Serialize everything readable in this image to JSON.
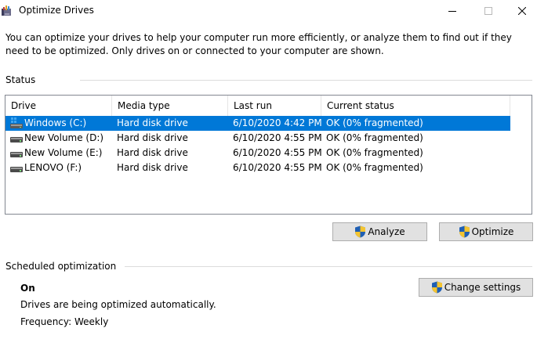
{
  "window": {
    "title": "Optimize Drives",
    "app_icon": "optimize-drives-icon",
    "controls": [
      "minimize-icon",
      "maximize-icon",
      "close-icon"
    ]
  },
  "intro_text": "You can optimize your drives to help your computer run more efficiently, or analyze them to find out if they need to be optimized. Only drives on or connected to your computer are shown.",
  "status": {
    "label": "Status",
    "columns": [
      "Drive",
      "Media type",
      "Last run",
      "Current status"
    ],
    "rows": [
      {
        "drive": "Windows (C:)",
        "icon": "system-drive-icon",
        "media": "Hard disk drive",
        "last_run": "6/10/2020 4:42 PM",
        "status": "OK (0% fragmented)",
        "selected": true
      },
      {
        "drive": "New Volume (D:)",
        "icon": "hard-drive-icon",
        "media": "Hard disk drive",
        "last_run": "6/10/2020 4:55 PM",
        "status": "OK (0% fragmented)",
        "selected": false
      },
      {
        "drive": "New Volume (E:)",
        "icon": "hard-drive-icon",
        "media": "Hard disk drive",
        "last_run": "6/10/2020 4:55 PM",
        "status": "OK (0% fragmented)",
        "selected": false
      },
      {
        "drive": "LENOVO (F:)",
        "icon": "hard-drive-icon",
        "media": "Hard disk drive",
        "last_run": "6/10/2020 4:55 PM",
        "status": "OK (0% fragmented)",
        "selected": false
      }
    ]
  },
  "actions": {
    "analyze_label": "Analyze",
    "optimize_label": "Optimize",
    "shield_icon": "uac-shield-icon"
  },
  "scheduled": {
    "label": "Scheduled optimization",
    "state": "On",
    "description": "Drives are being optimized automatically.",
    "frequency": "Frequency: Weekly",
    "change_label": "Change settings"
  },
  "colors": {
    "selection": "#0078d7",
    "button_face": "#e1e1e1",
    "button_border": "#adadad",
    "list_border": "#828790"
  }
}
